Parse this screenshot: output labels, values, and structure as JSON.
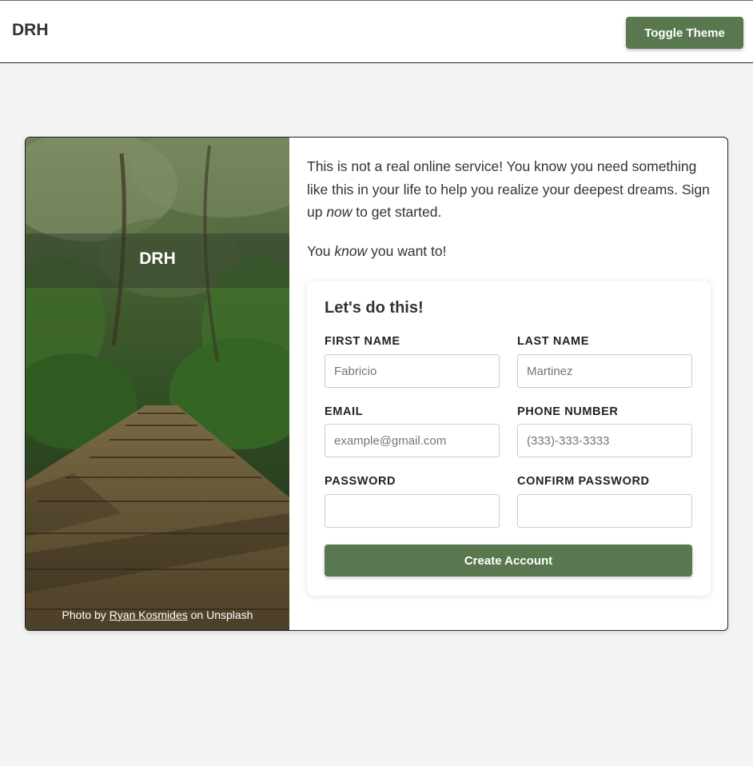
{
  "header": {
    "brand": "DRH",
    "toggle_label": "Toggle Theme"
  },
  "photo": {
    "logo": "DRH",
    "credit_prefix": "Photo by ",
    "credit_author": "Ryan Kosmides",
    "credit_suffix": " on Unsplash"
  },
  "intro": {
    "p1_before": "This is not a real online service! You know you need something like this in your life to help you realize your deepest dreams. Sign up ",
    "p1_emph": "now",
    "p1_after": " to get started.",
    "p2_before": "You ",
    "p2_emph": "know",
    "p2_after": " you want to!"
  },
  "form": {
    "title": "Let's do this!",
    "first_name_label": "FIRST NAME",
    "first_name_placeholder": "Fabricio",
    "last_name_label": "LAST NAME",
    "last_name_placeholder": "Martinez",
    "email_label": "EMAIL",
    "email_placeholder": "example@gmail.com",
    "phone_label": "PHONE NUMBER",
    "phone_placeholder": "(333)-333-3333",
    "password_label": "PASSWORD",
    "confirm_label": "CONFIRM PASSWORD",
    "submit_label": "Create Account"
  },
  "colors": {
    "accent": "#5a7850",
    "background": "#f3f3f3"
  }
}
